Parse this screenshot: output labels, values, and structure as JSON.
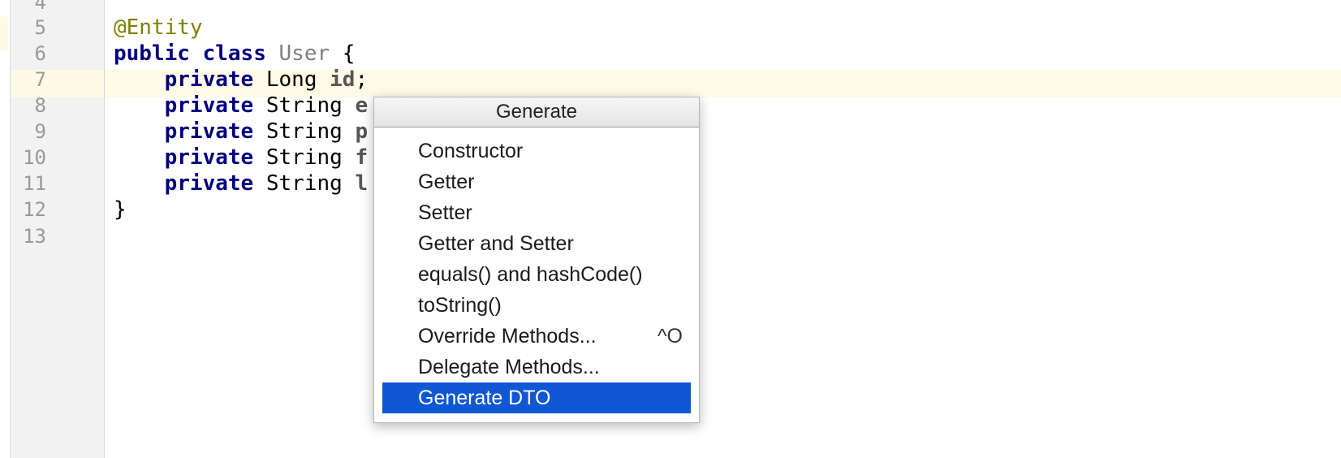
{
  "editor": {
    "line_numbers": [
      "4",
      "5",
      "6",
      "7",
      "8",
      "9",
      "10",
      "11",
      "12",
      "13"
    ],
    "lines": {
      "l5": {
        "annotation": "@Entity"
      },
      "l6": {
        "kw1": "public",
        "kw2": "class",
        "class_name": "User",
        "brace": "{"
      },
      "l7": {
        "kw": "private",
        "type": "Long",
        "field": "id",
        "semi": ";"
      },
      "l8": {
        "kw": "private",
        "type": "String",
        "field_visible": "e"
      },
      "l9": {
        "kw": "private",
        "type": "String",
        "field_visible": "p"
      },
      "l10": {
        "kw": "private",
        "type": "String",
        "field_visible": "f"
      },
      "l11": {
        "kw": "private",
        "type": "String",
        "field_visible": "l"
      },
      "l12": {
        "brace": "}"
      }
    }
  },
  "popup": {
    "title": "Generate",
    "items": [
      {
        "label": "Constructor",
        "shortcut": ""
      },
      {
        "label": "Getter",
        "shortcut": ""
      },
      {
        "label": "Setter",
        "shortcut": ""
      },
      {
        "label": "Getter and Setter",
        "shortcut": ""
      },
      {
        "label": "equals() and hashCode()",
        "shortcut": ""
      },
      {
        "label": "toString()",
        "shortcut": ""
      },
      {
        "label": "Override Methods...",
        "shortcut": "^O"
      },
      {
        "label": "Delegate Methods...",
        "shortcut": ""
      },
      {
        "label": "Generate DTO",
        "shortcut": "",
        "selected": true
      }
    ]
  },
  "colors": {
    "selection": "#0f57d4",
    "keyword": "#000080",
    "annotation": "#808000",
    "current_line": "#fefbe6"
  }
}
